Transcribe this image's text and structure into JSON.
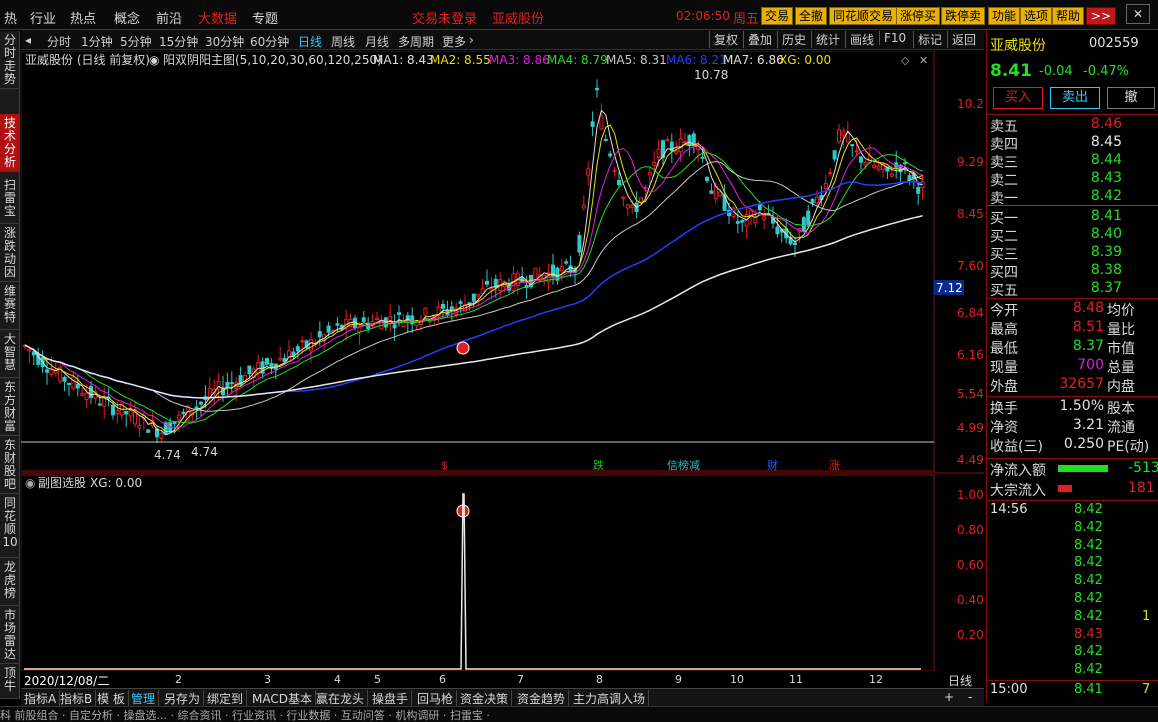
{
  "top": {
    "menu": [
      "热",
      "行业",
      "热点",
      "概念",
      "前沿",
      "大数据",
      "专题"
    ],
    "status": "交易未登录",
    "stock": "亚威股份",
    "time": "02:06:50",
    "weekday": "周五",
    "buttons": [
      "交易",
      "全撤",
      "同花顺交易",
      "涨停买",
      "跌停卖",
      "功能",
      "选项",
      "帮助",
      ">>"
    ],
    "close": "✕"
  },
  "left_tabs": [
    "分时走势",
    "技术分析",
    "扫雷宝",
    "涨跌动因",
    "维赛特",
    "大智慧",
    "东方财富",
    "东财股吧",
    "同花顺10",
    "龙虎榜",
    "市场雷达",
    "顶牛"
  ],
  "toolbar": {
    "periods": [
      "分时",
      "1分钟",
      "5分钟",
      "15分钟",
      "30分钟",
      "60分钟",
      "日线",
      "周线",
      "月线",
      "多周期",
      "更多"
    ],
    "more_arrow": "›",
    "right": [
      "复权",
      "叠加",
      "历史",
      "统计",
      "画线",
      "F10",
      "标记",
      "返回"
    ]
  },
  "indicator_bar": {
    "title": "亚威股份 (日线 前复权)",
    "formula": "阳双阴阳主图(5,10,20,30,60,120,250)",
    "ma": [
      {
        "label": "MA1: 8.43",
        "color": "#e0e0e0"
      },
      {
        "label": "MA2: 8.55",
        "color": "#e8e000"
      },
      {
        "label": "MA3: 8.86",
        "color": "#e020e0"
      },
      {
        "label": "MA4: 8.79",
        "color": "#20e020"
      },
      {
        "label": "MA5: 8.31",
        "color": "#c8c8c8"
      },
      {
        "label": "MA6: 8.21",
        "color": "#2040ff"
      },
      {
        "label": "MA7: 6.86",
        "color": "#e0e0e0"
      },
      {
        "label": "XG: 0.00",
        "color": "#e8e000"
      }
    ]
  },
  "main_axis": {
    "ticks": [
      "10.22",
      "9.29",
      "8.45",
      "7.60",
      "6.84",
      "6.16",
      "5.54",
      "4.99",
      "4.49"
    ],
    "current_tag": "7.12",
    "high_label": "10.78",
    "low_label": "4.74",
    "low_label2": "4.74"
  },
  "event_markers": [
    {
      "text": "$",
      "color": "#e02020"
    },
    {
      "text": "跌",
      "color": "#20c020"
    },
    {
      "text": "信榜减",
      "color": "#20c0c0"
    },
    {
      "text": "财",
      "color": "#2060ff"
    },
    {
      "text": "涨",
      "color": "#e02020"
    }
  ],
  "sub_chart": {
    "title": "副图选股",
    "xg": "XG: 0.00",
    "ticks": [
      "1.00",
      "0.80",
      "0.60",
      "0.40",
      "0.20"
    ]
  },
  "date_axis": {
    "current_date": "2020/12/08/二",
    "months": [
      "2",
      "3",
      "4",
      "5",
      "6",
      "7",
      "8",
      "9",
      "10",
      "11",
      "12"
    ],
    "period_label": "日线"
  },
  "bottom_tabs": [
    "指标A",
    "指标B",
    "模 板",
    "管理",
    "另存为",
    "绑定到",
    "MACD基本",
    "赢在龙头",
    "操盘手",
    "回马枪",
    "资金决策",
    "资金趋势",
    "主力高调入场"
  ],
  "bottom_tab_ctl": [
    "+",
    "-"
  ],
  "bottom_strip": "科     前股组合 · 自定分析 · 操盘选... · 综合资讯 · 行业资讯 · 行业数据 · 互动问答 · 机构调研 · 扫雷宝 ·",
  "quote": {
    "name": "亚威股份",
    "code": "002559",
    "price": "8.41",
    "change": "-0.04",
    "pct": "-0.47%",
    "buy": "买入",
    "sell": "卖出",
    "cancel": "撤",
    "asks": [
      {
        "label": "卖五",
        "price": "8.46",
        "color": "#e02020"
      },
      {
        "label": "卖四",
        "price": "8.45",
        "color": "#e8e8e8"
      },
      {
        "label": "卖三",
        "price": "8.44",
        "color": "#20e020"
      },
      {
        "label": "卖二",
        "price": "8.43",
        "color": "#20e020"
      },
      {
        "label": "卖一",
        "price": "8.42",
        "color": "#20e020"
      }
    ],
    "bids": [
      {
        "label": "买一",
        "price": "8.41",
        "color": "#20e020"
      },
      {
        "label": "买二",
        "price": "8.40",
        "color": "#20e020"
      },
      {
        "label": "买三",
        "price": "8.39",
        "color": "#20e020"
      },
      {
        "label": "买四",
        "price": "8.38",
        "color": "#20e020"
      },
      {
        "label": "买五",
        "price": "8.37",
        "color": "#20e020"
      }
    ],
    "stats": [
      {
        "label": "今开",
        "value": "8.48",
        "color": "#e02020",
        "label2": "均价"
      },
      {
        "label": "最高",
        "value": "8.51",
        "color": "#e02020",
        "label2": "量比"
      },
      {
        "label": "最低",
        "value": "8.37",
        "color": "#20e020",
        "label2": "市值"
      },
      {
        "label": "现量",
        "value": "700",
        "color": "#e020e0",
        "label2": "总量"
      },
      {
        "label": "外盘",
        "value": "32657",
        "color": "#e02020",
        "label2": "内盘"
      }
    ],
    "stats2": [
      {
        "label": "换手",
        "value": "1.50%",
        "label2": "股本"
      },
      {
        "label": "净资",
        "value": "3.21",
        "label2": "流通"
      },
      {
        "label": "收益(三)",
        "value": "0.250",
        "label2": "PE(动)"
      }
    ],
    "flows": [
      {
        "label": "净流入额",
        "value": "-513",
        "color": "#20e020",
        "fill": 0.9
      },
      {
        "label": "大宗流入",
        "value": "181",
        "color": "#e02020",
        "fill": 0.25
      }
    ],
    "ticks_header": "14:56",
    "ticks": [
      {
        "price": "8.42",
        "vol": ""
      },
      {
        "price": "8.42",
        "vol": ""
      },
      {
        "price": "8.42",
        "vol": ""
      },
      {
        "price": "8.42",
        "vol": ""
      },
      {
        "price": "8.42",
        "vol": ""
      },
      {
        "price": "8.42",
        "vol": ""
      },
      {
        "price": "8.42",
        "vol": "1"
      },
      {
        "price": "8.43",
        "vol": ""
      },
      {
        "price": "8.42",
        "vol": ""
      },
      {
        "price": "8.42",
        "vol": ""
      }
    ],
    "last_tick": {
      "time": "15:00",
      "price": "8.41",
      "vol": "7"
    }
  },
  "colors": {
    "up": "#e02020",
    "down": "#20e020",
    "axis_red": "#8a1010",
    "ma_blue": "#2040ff",
    "ma_white": "#e0e0e0"
  }
}
